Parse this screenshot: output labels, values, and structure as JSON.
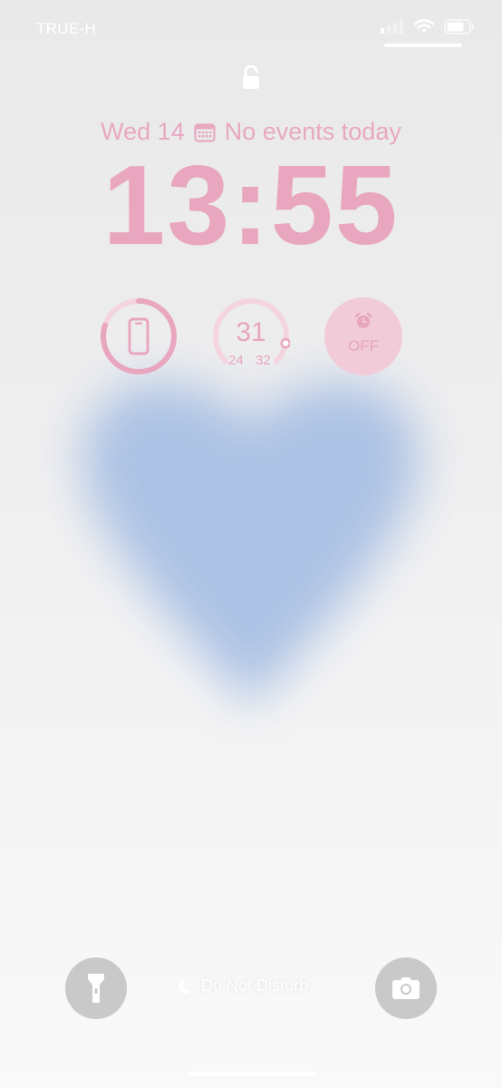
{
  "status_bar": {
    "carrier": "TRUE-H",
    "signal_bars_active": 1,
    "signal_bars_total": 4
  },
  "lock_screen": {
    "date": "Wed 14",
    "events": "No events today",
    "time": "13:55"
  },
  "widgets": {
    "phone_battery": {
      "icon": "phone-icon",
      "level": 0.8
    },
    "weather": {
      "current": "31",
      "low": "24",
      "high": "32",
      "range_fraction": 0.875
    },
    "alarm": {
      "icon": "alarm-clock-icon",
      "status": "OFF"
    }
  },
  "bottom_controls": {
    "flashlight_icon": "flashlight-icon",
    "focus_mode": "Do Not Disturb",
    "camera_icon": "camera-icon"
  },
  "colors": {
    "accent_pink": "#e9a6bf",
    "heart_blue": "#a9c0e4",
    "background": "#eeeeef"
  }
}
